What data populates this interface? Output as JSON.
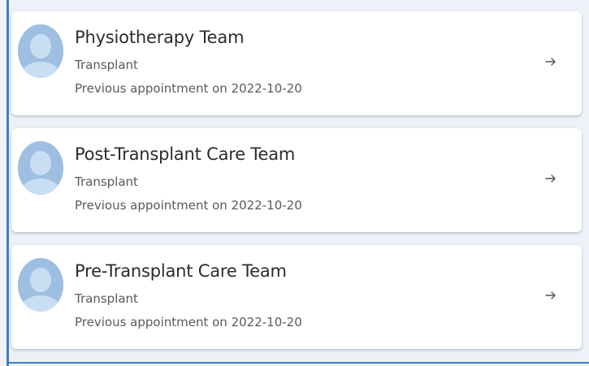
{
  "teams": [
    {
      "name": "Physiotherapy Team",
      "department": "Transplant",
      "appointment": "Previous appointment on 2022-10-20"
    },
    {
      "name": "Post-Transplant Care Team",
      "department": "Transplant",
      "appointment": "Previous appointment on 2022-10-20"
    },
    {
      "name": "Pre-Transplant Care Team",
      "department": "Transplant",
      "appointment": "Previous appointment on 2022-10-20"
    }
  ],
  "icons": {
    "avatar": "person-avatar-icon",
    "arrow": "arrow-right-icon"
  },
  "colors": {
    "background": "#eef1f7",
    "card": "#ffffff",
    "accent": "#3d7fc7",
    "avatar": "#9ebfe2"
  }
}
